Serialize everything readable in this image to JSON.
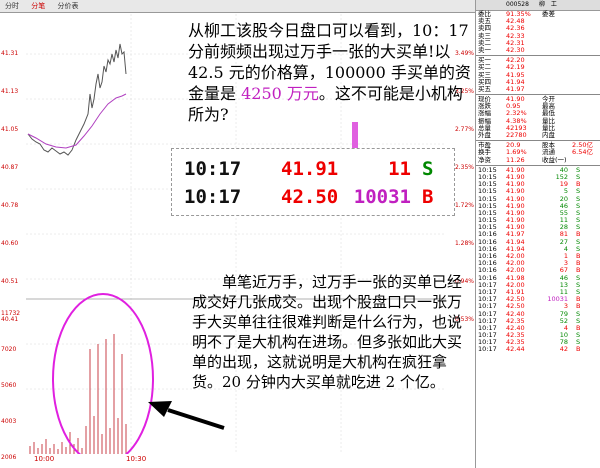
{
  "chart": {
    "tabs": [
      "分时",
      "分笔",
      "分价表"
    ],
    "axis_left": [
      "41.31",
      "41.13",
      "41.05",
      "40.87",
      "40.78",
      "40.60",
      "40.51",
      "40.41"
    ],
    "axis_right": [
      "3.49%",
      "3.25%",
      "2.77%",
      "2.35%",
      "1.72%",
      "1.28%",
      "0.94%",
      "0.53%"
    ],
    "vol_labels": [
      "11732",
      "7020",
      "5060",
      "4003",
      "2006"
    ],
    "time_labels": [
      "10:00",
      "10:30"
    ]
  },
  "annotation_top": {
    "part1": "从柳工该股今日盘口可以看到，10：17 分前频频出现过万手一张的大买单!以 42.5 元的价格算，100000 手买单的资金量是 ",
    "highlight": "4250 万元",
    "part2": "。这不可能是小机构所为?"
  },
  "annotation_bottom": "单笔近万手，过万手一张的买单已经成交好几张成交。出现个股盘口只一张万手大买单往往很难判断是什么行为，也说明不了是大机构在进场。但多张如此大买单的出现，这就说明是大机构在疯狂拿货。20 分钟内大买单就吃进 2 个亿。",
  "trade_box": {
    "rows": [
      {
        "time": "10:17",
        "price": "41.91",
        "volume": "11",
        "direction": "S",
        "vol_color": "#e00",
        "dir_color": "#080"
      },
      {
        "time": "10:17",
        "price": "42.50",
        "volume": "10031",
        "direction": "B",
        "vol_color": "#c020c0",
        "dir_color": "#e00"
      }
    ]
  },
  "panel": {
    "code": "000528",
    "name": "柳　工",
    "quote_rows": [
      [
        "委比",
        "91.35%",
        "委差",
        ""
      ],
      [
        "卖五",
        "42.48",
        "",
        ""
      ],
      [
        "卖四",
        "42.36",
        "",
        ""
      ],
      [
        "卖三",
        "42.33",
        "",
        ""
      ],
      [
        "卖二",
        "42.31",
        "",
        ""
      ],
      [
        "卖一",
        "42.30",
        "",
        ""
      ]
    ],
    "bid_rows": [
      [
        "买一",
        "42.20",
        "",
        ""
      ],
      [
        "买二",
        "42.19",
        "",
        ""
      ],
      [
        "买三",
        "41.95",
        "",
        ""
      ],
      [
        "买四",
        "41.94",
        "",
        ""
      ],
      [
        "买五",
        "41.97",
        "",
        ""
      ]
    ],
    "stats_rows": [
      [
        "现价",
        "41.90",
        "今开",
        ""
      ],
      [
        "涨跌",
        "0.95",
        "最高",
        ""
      ],
      [
        "涨幅",
        "2.32%",
        "最低",
        ""
      ],
      [
        "振幅",
        "4.38%",
        "量比",
        ""
      ],
      [
        "总量",
        "42193",
        "量比",
        ""
      ],
      [
        "外盘",
        "22780",
        "内盘",
        ""
      ]
    ],
    "extra_rows": [
      [
        "市盈",
        "20.9",
        "股本",
        "2.50亿"
      ],
      [
        "换手",
        "1.69%",
        "流通",
        "6.54亿"
      ],
      [
        "净资",
        "11.26",
        "收益(一)",
        ""
      ]
    ],
    "ticks": [
      [
        "10:15",
        "41.90",
        "40",
        "S"
      ],
      [
        "10:15",
        "41.90",
        "152",
        "S"
      ],
      [
        "10:15",
        "41.90",
        "19",
        "B"
      ],
      [
        "10:15",
        "41.90",
        "5",
        "S"
      ],
      [
        "10:15",
        "41.90",
        "20",
        "S"
      ],
      [
        "10:15",
        "41.90",
        "46",
        "S"
      ],
      [
        "10:15",
        "41.90",
        "55",
        "S"
      ],
      [
        "10:15",
        "41.90",
        "11",
        "S"
      ],
      [
        "10:15",
        "41.90",
        "28",
        "S"
      ],
      [
        "10:16",
        "41.97",
        "81",
        "B"
      ],
      [
        "10:16",
        "41.94",
        "27",
        "S"
      ],
      [
        "10:16",
        "41.94",
        "4",
        "S"
      ],
      [
        "10:16",
        "42.00",
        "1",
        "B"
      ],
      [
        "10:16",
        "42.00",
        "3",
        "B"
      ],
      [
        "10:16",
        "42.00",
        "67",
        "B"
      ],
      [
        "10:16",
        "41.98",
        "46",
        "S"
      ],
      [
        "10:17",
        "42.00",
        "13",
        "S"
      ],
      [
        "10:17",
        "41.91",
        "11",
        "S"
      ],
      [
        "10:17",
        "42.50",
        "10031",
        "B"
      ],
      [
        "10:17",
        "42.50",
        "3",
        "B"
      ],
      [
        "10:17",
        "42.40",
        "79",
        "S"
      ],
      [
        "10:17",
        "42.35",
        "52",
        "S"
      ],
      [
        "10:17",
        "42.40",
        "4",
        "B"
      ],
      [
        "10:17",
        "42.35",
        "10",
        "S"
      ],
      [
        "10:17",
        "42.35",
        "78",
        "S"
      ],
      [
        "10:17",
        "42.44",
        "42",
        "B"
      ]
    ]
  }
}
